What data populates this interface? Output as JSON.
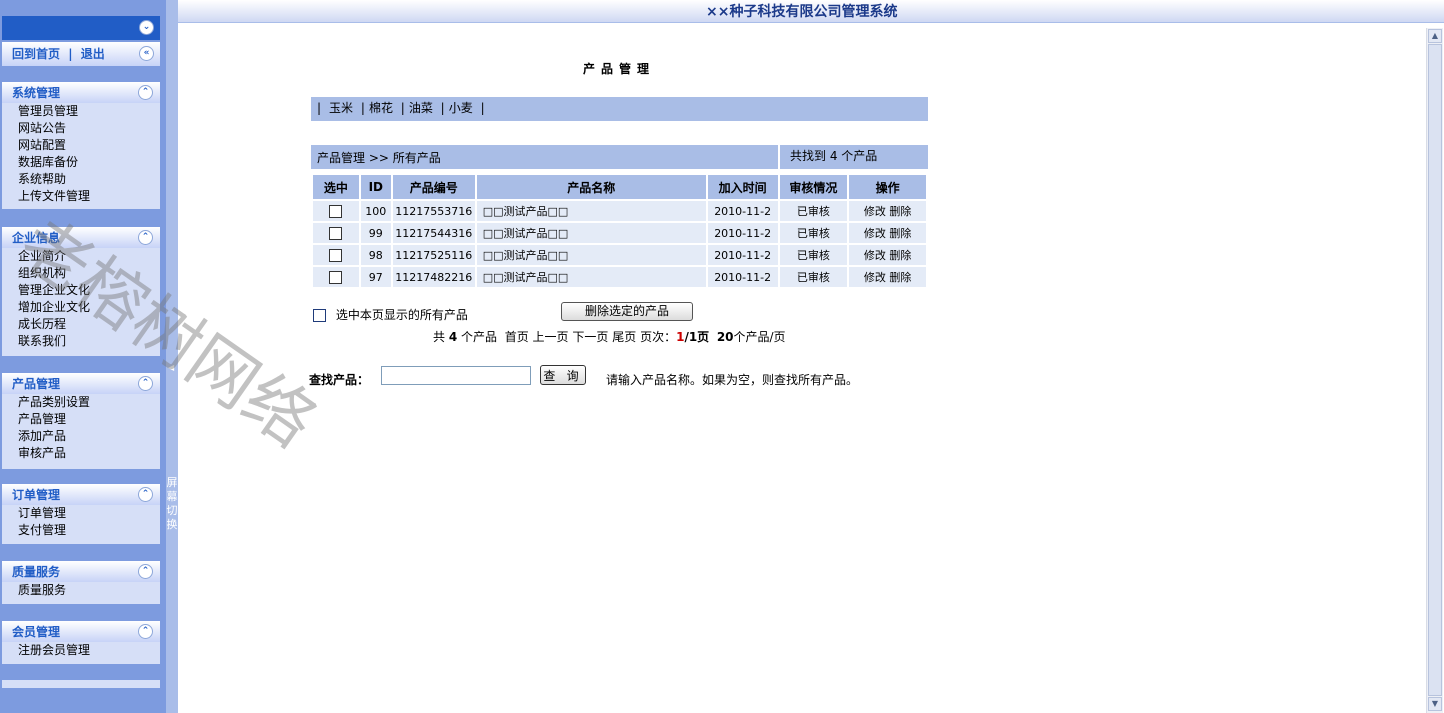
{
  "app_title": "××种子科技有限公司管理系统",
  "sidebar": {
    "home_link": "回到首页",
    "separator": "|",
    "logout_link": "退出",
    "groups": [
      {
        "title": "系统管理",
        "items": [
          "管理员管理",
          "网站公告",
          "网站配置",
          "数据库备份",
          "系统帮助",
          "上传文件管理"
        ]
      },
      {
        "title": "企业信息",
        "items": [
          "企业简介",
          "组织机构",
          "管理企业文化",
          "增加企业文化",
          "成长历程",
          "联系我们"
        ]
      },
      {
        "title": "产品管理",
        "items": [
          "产品类别设置",
          "产品管理",
          "添加产品",
          "审核产品"
        ]
      },
      {
        "title": "订单管理",
        "items": [
          "订单管理",
          "支付管理"
        ]
      },
      {
        "title": "质量服务",
        "items": [
          "质量服务"
        ]
      },
      {
        "title": "会员管理",
        "items": [
          "注册会员管理"
        ]
      }
    ]
  },
  "splitter_label": "屏幕切换",
  "main": {
    "page_title": "产品管理",
    "categories": [
      "玉米",
      "棉花",
      "油菜",
      "小麦"
    ],
    "breadcrumb": "产品管理 >> 所有产品",
    "found_text": "共找到 4 个产品",
    "columns": [
      "选中",
      "ID",
      "产品编号",
      "产品名称",
      "加入时间",
      "审核情况",
      "操作"
    ],
    "rows": [
      {
        "id": "100",
        "code": "11217553716",
        "name": "□□测试产品□□",
        "date": "2010-11-2",
        "status": "已审核",
        "edit": "修改",
        "delete": "删除"
      },
      {
        "id": "99",
        "code": "11217544316",
        "name": "□□测试产品□□",
        "date": "2010-11-2",
        "status": "已审核",
        "edit": "修改",
        "delete": "删除"
      },
      {
        "id": "98",
        "code": "11217525116",
        "name": "□□测试产品□□",
        "date": "2010-11-2",
        "status": "已审核",
        "edit": "修改",
        "delete": "删除"
      },
      {
        "id": "97",
        "code": "11217482216",
        "name": "□□测试产品□□",
        "date": "2010-11-2",
        "status": "已审核",
        "edit": "修改",
        "delete": "删除"
      }
    ],
    "select_all_label": "选中本页显示的所有产品",
    "delete_selected_label": "删除选定的产品",
    "pager": {
      "total_prefix": "共",
      "total": "4",
      "total_suffix": "个产品",
      "first": "首页",
      "prev": "上一页",
      "next": "下一页",
      "last": "尾页",
      "page_label": "页次：",
      "current": "1",
      "pages": "/1页",
      "per_page": "20",
      "per_page_suffix": "个产品/页"
    },
    "search": {
      "label": "查找产品：",
      "value": "",
      "button": "查 询",
      "hint": "请输入产品名称。如果为空，则查找所有产品。"
    }
  },
  "watermark": "老榕树网络",
  "colors": {
    "sidebar_bg": "#7d9bdf",
    "panel_bg": "#d6dff7",
    "header_blue": "#215dc6",
    "table_header": "#a9bde6",
    "row_bg": "#e4ebf7"
  }
}
